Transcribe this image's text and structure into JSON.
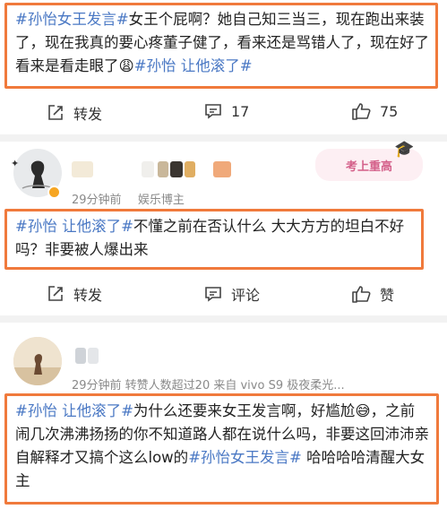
{
  "post1": {
    "segments": [
      {
        "text": "#孙怡女王发言#",
        "tag": true
      },
      {
        "text": "女王个屁啊？她自己知三当三，现在跑出来装了，现在我真的要心疼董子健了，看来还是骂错人了，现在好了看来是看走眼了😩",
        "tag": false
      },
      {
        "text": "#孙怡 让他滚了#",
        "tag": true
      }
    ],
    "actions": {
      "repost": "转发",
      "comments": "17",
      "likes": "75"
    }
  },
  "post2": {
    "meta_time": "29分钟前",
    "meta_role": "娱乐博主",
    "badge": "考上重高",
    "segments": [
      {
        "text": "#孙怡 让他滚了#",
        "tag": true
      },
      {
        "text": "不懂之前在否认什么 大大方方的坦白不好吗？非要被人爆出来",
        "tag": false
      }
    ],
    "actions": {
      "repost": "转发",
      "comment": "评论",
      "like": "赞"
    }
  },
  "post3": {
    "meta": "29分钟前  转赞人数超过20   来自 vivo S9 极夜柔光...",
    "segments": [
      {
        "text": "#孙怡 让他滚了#",
        "tag": true
      },
      {
        "text": "为什么还要来女王发言啊，好尴尬😅，之前闹几次沸沸扬扬的你不知道路人都在说什么吗，非要这回沛沛亲自解释才又搞个这么low的",
        "tag": false
      },
      {
        "text": "#孙怡女王发言#",
        "tag": true
      },
      {
        "text": " 哈哈哈哈清醒大女主",
        "tag": false
      }
    ]
  },
  "colors": {
    "topic": "#4a78c4",
    "highlight": "#f07a3c",
    "meta": "#8a8a8a"
  }
}
